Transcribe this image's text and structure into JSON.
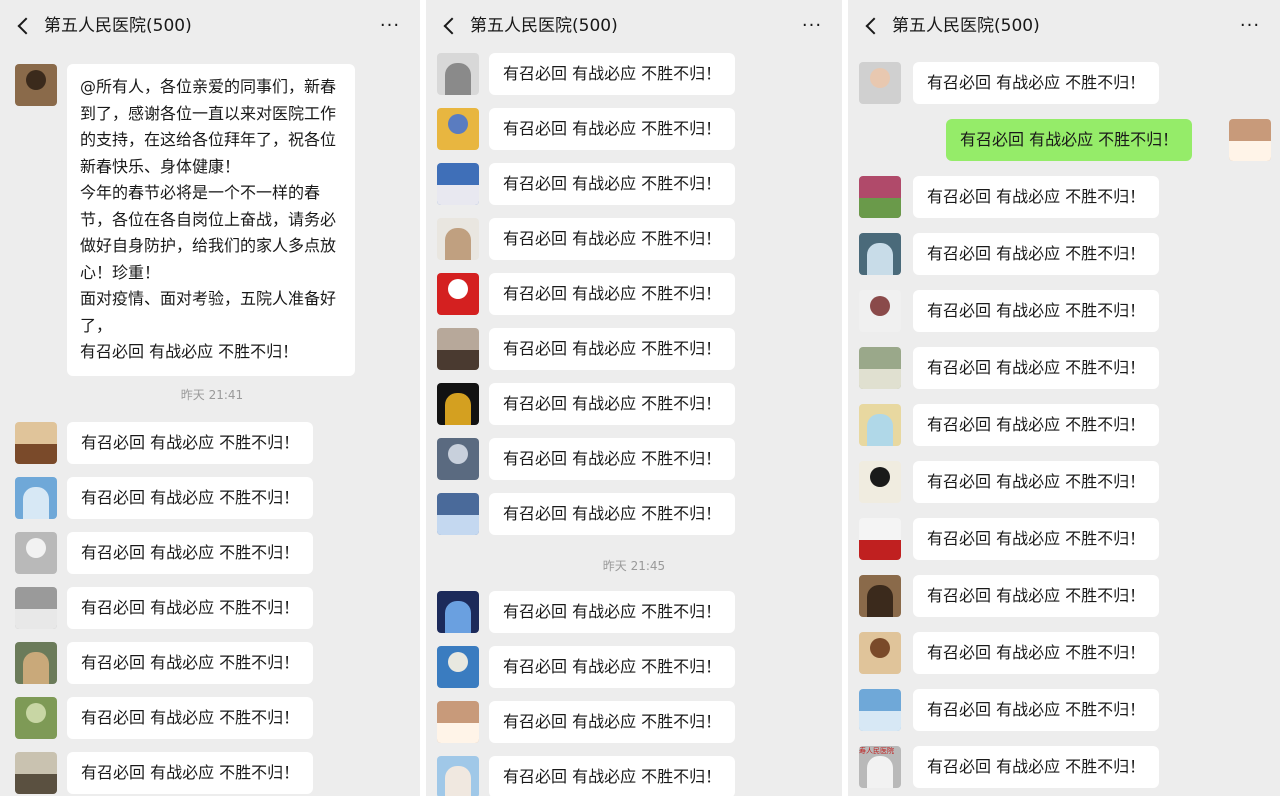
{
  "chat_title": "第五人民医院(500)",
  "more_label": "···",
  "panels": [
    {
      "first_message": "@所有人，各位亲爱的同事们，新春到了，感谢各位一直以来对医院工作的支持，在这给各位拜年了，祝各位新春快乐、身体健康！\n今年的春节必将是一个不一样的春节，各位在各自岗位上奋战，请务必做好自身防护，给我们的家人多点放心！珍重！\n面对疫情、面对考验，五院人准备好了，\n有召必回 有战必应 不胜不归！",
      "timestamp": "昨天 21:41",
      "messages": [
        "有召必回 有战必应 不胜不归！",
        "有召必回 有战必应 不胜不归！",
        "有召必回 有战必应 不胜不归！",
        "有召必回 有战必应 不胜不归！",
        "有召必回 有战必应 不胜不归！",
        "有召必回 有战必应 不胜不归！",
        "有召必回 有战必应 不胜不归！"
      ]
    },
    {
      "messages_before": [
        "有召必回 有战必应 不胜不归！",
        "有召必回 有战必应 不胜不归！",
        "有召必回 有战必应 不胜不归！",
        "有召必回 有战必应 不胜不归！",
        "有召必回 有战必应 不胜不归！",
        "有召必回 有战必应 不胜不归！",
        "有召必回 有战必应 不胜不归！",
        "有召必回 有战必应 不胜不归！",
        "有召必回 有战必应 不胜不归！"
      ],
      "timestamp": "昨天 21:45",
      "messages_after": [
        "有召必回 有战必应 不胜不归！",
        "有召必回 有战必应 不胜不归！",
        "有召必回 有战必应 不胜不归！",
        "有召必回 有战必应 不胜不归！"
      ]
    },
    {
      "messages_before": [
        "有召必回 有战必应 不胜不归！"
      ],
      "self_message": "有召必回 有战必应 不胜不归！",
      "messages_after": [
        "有召必回 有战必应 不胜不归！",
        "有召必回 有战必应 不胜不归！",
        "有召必回 有战必应 不胜不归！",
        "有召必回 有战必应 不胜不归！",
        "有召必回 有战必应 不胜不归！",
        "有召必回 有战必应 不胜不归！",
        "有召必回 有战必应 不胜不归！",
        "有召必回 有战必应 不胜不归！",
        "有召必回 有战必应 不胜不归！",
        "有召必回 有战必应 不胜不归！",
        "有召必回 有战必应 不胜不归！"
      ],
      "avatar_badge_text": "寿人民医院"
    }
  ],
  "colors": {
    "background": "#ededed",
    "bubble": "#ffffff",
    "self_bubble": "#95ec69",
    "timestamp": "#9a9a9a"
  }
}
